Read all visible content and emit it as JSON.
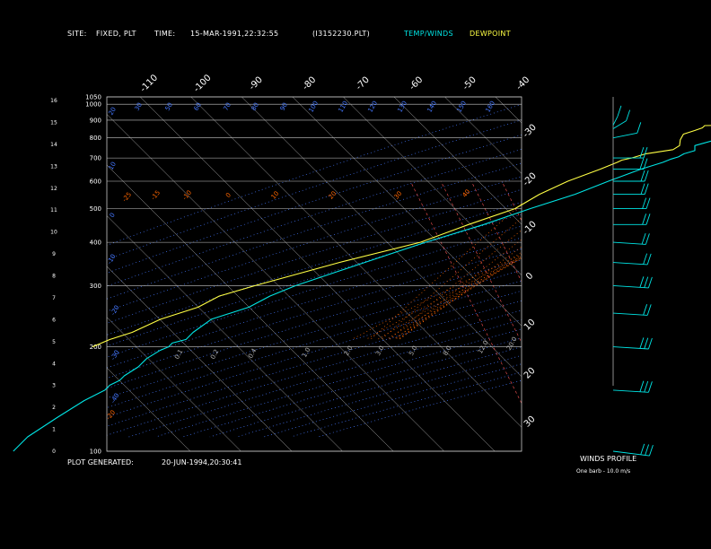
{
  "header": {
    "site_label": "SITE:",
    "site_value": "FIXED, PLT",
    "time_label": "TIME:",
    "time_value": "15-MAR-1991,22:32:55",
    "file_value": "(I3152230.PLT)",
    "temp_legend": "TEMP/WINDS",
    "dew_legend": "DEWPOINT"
  },
  "footer": {
    "generated_label": "PLOT GENERATED:",
    "generated_value": "20-JUN-1994,20:30:41",
    "winds_title": "WINDS PROFILE",
    "barb_note": "One barb - 10.0 m/s"
  },
  "colors": {
    "background": "#000000",
    "temperature": "#00e5e5",
    "dewpoint": "#ffff44",
    "isobar": "#c8c8c8",
    "isotherm": "#b4b4b4",
    "dry_adiabat": "#4477ff",
    "moist_adiabat": "#ff6600",
    "mixing_ratio": "#ff5555"
  },
  "chart_data": {
    "type": "line",
    "diagram": "skew-t log-p",
    "pressure_levels": [
      100,
      200,
      300,
      400,
      500,
      600,
      700,
      800,
      900,
      1000,
      1050
    ],
    "pressure_labels": [
      "100",
      "200",
      "300",
      "400",
      "500",
      "600",
      "700",
      "800",
      "900",
      "1000",
      "1050"
    ],
    "ylim": [
      1050,
      100
    ],
    "height_labels": [
      "16",
      "15",
      "14",
      "13",
      "12",
      "11",
      "10",
      "9",
      "8",
      "7",
      "6",
      "5",
      "4",
      "3",
      "2",
      "1",
      "0"
    ],
    "height_values": [
      16,
      15,
      14,
      13,
      12,
      11,
      10,
      9,
      8,
      7,
      6,
      5,
      4,
      3,
      2,
      1,
      0
    ],
    "isotherm_values": [
      -110,
      -100,
      -90,
      -80,
      -70,
      -60,
      -50,
      -40,
      -30,
      -20,
      -10,
      0,
      10,
      20,
      30
    ],
    "isotherm_labels_top": [
      "-110",
      "-100",
      "-90",
      "-80",
      "-70",
      "-60",
      "-50",
      "-40"
    ],
    "isotherm_labels_right": [
      "-30",
      "-20",
      "-10",
      "0",
      "10",
      "20",
      "30"
    ],
    "dry_adiabat_labels": [
      "20",
      "30",
      "50",
      "60",
      "70",
      "80",
      "90",
      "100",
      "110",
      "120",
      "130",
      "140",
      "150",
      "160",
      "10",
      "0",
      "-10",
      "-20",
      "-30",
      "-40"
    ],
    "moist_adiabat_labels": [
      "-25",
      "-15",
      "-10",
      "0",
      "10",
      "20",
      "30",
      "40",
      "-20"
    ],
    "mixing_ratio_labels": [
      "0.1",
      "0.2",
      "0.4",
      "1.0",
      "2.0",
      "3.0",
      "5.0",
      "8.0",
      "12.0",
      "20.0"
    ],
    "series": [
      {
        "name": "TEMP/WINDS",
        "pressure": [
          870,
          855,
          820,
          790,
          760,
          735,
          720,
          705,
          695,
          680,
          650,
          600,
          550,
          500,
          450,
          400,
          350,
          300,
          280,
          260,
          240,
          220,
          210,
          205,
          200,
          195,
          185,
          175,
          165,
          160,
          155,
          150,
          140,
          125,
          110,
          100
        ],
        "temperature": [
          11,
          7,
          4,
          2,
          -1,
          0,
          -1.5,
          -2,
          -3,
          -4,
          -7,
          -11,
          -15,
          -21,
          -27,
          -35,
          -43,
          -52,
          -55,
          -57,
          -62,
          -63,
          -63,
          -65,
          -65,
          -66,
          -67,
          -67,
          -68,
          -68,
          -69,
          -69,
          -71,
          -73,
          -75,
          -75
        ]
      },
      {
        "name": "DEWPOINT",
        "pressure": [
          870,
          868,
          855,
          840,
          820,
          790,
          760,
          740,
          720,
          700,
          690,
          680,
          650,
          600,
          550,
          500,
          450,
          400,
          350,
          300,
          280,
          260,
          240,
          220,
          210,
          200
        ],
        "temperature": [
          1,
          -3,
          -3,
          -4,
          -5.5,
          -5,
          -4,
          -4.5,
          -9,
          -11,
          -12.5,
          -13,
          -15,
          -19,
          -22,
          -24,
          -30,
          -36,
          -48,
          -60,
          -65,
          -67,
          -72,
          -75,
          -78,
          -80
        ]
      }
    ],
    "winds": {
      "pressure": [
        100,
        150,
        200,
        250,
        300,
        350,
        400,
        450,
        500,
        550,
        600,
        650,
        700,
        800,
        850,
        870
      ],
      "speed_ms": [
        35,
        30,
        30,
        28,
        30,
        28,
        25,
        25,
        25,
        22,
        22,
        20,
        20,
        15,
        12,
        10
      ],
      "direction_deg": [
        290,
        280,
        280,
        280,
        280,
        280,
        280,
        270,
        270,
        270,
        270,
        270,
        270,
        240,
        210,
        190
      ]
    }
  }
}
